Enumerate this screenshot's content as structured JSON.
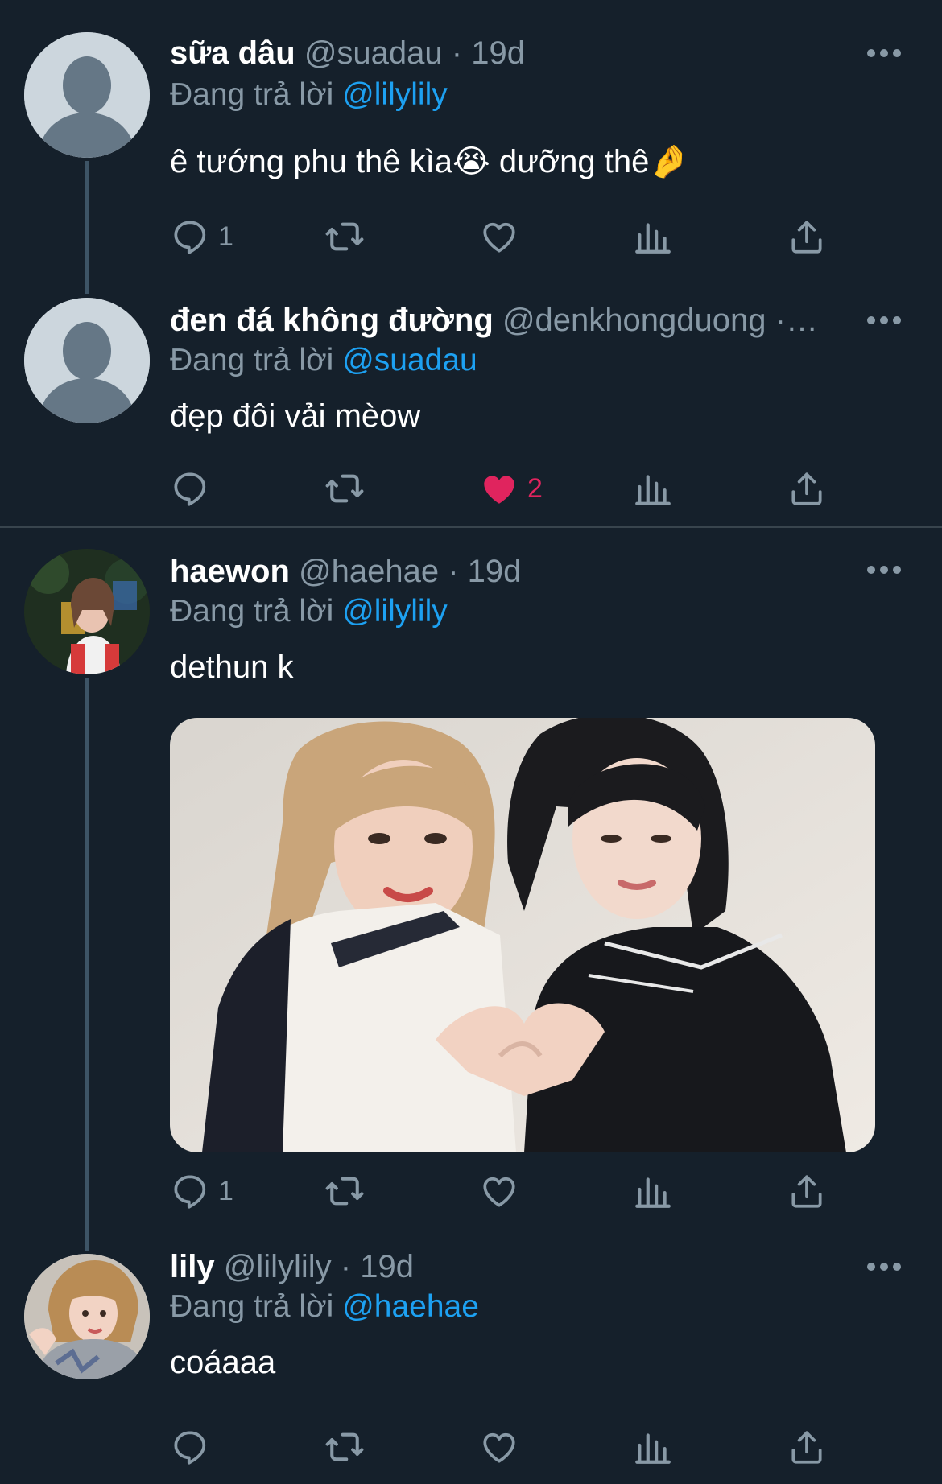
{
  "colors": {
    "background": "#15202b",
    "muted": "#8899a6",
    "link": "#1da1f2",
    "like_active": "#e0245e"
  },
  "tweets": [
    {
      "name": "sữa dâu",
      "handle": "@suadau",
      "time": "· 19d",
      "replying_label": "Đang trả lời",
      "replying_to": "@lilylily",
      "text": "ê tướng phu thê kìa😭 dưỡng thê🤌",
      "reply_count": "1",
      "retweet_count": "",
      "like_count": "",
      "liked": false
    },
    {
      "name": "đen đá không đường",
      "handle": "@denkhongduong ·…",
      "time": "",
      "replying_label": "Đang trả lời",
      "replying_to": "@suadau",
      "text": "đẹp đôi vải mèow",
      "reply_count": "",
      "retweet_count": "",
      "like_count": "2",
      "liked": true
    },
    {
      "name": "haewon",
      "handle": "@haehae",
      "time": "· 19d",
      "replying_label": "Đang trả lời",
      "replying_to": "@lilylily",
      "text": "dethun k",
      "reply_count": "1",
      "retweet_count": "",
      "like_count": "",
      "liked": false,
      "has_media": true
    },
    {
      "name": "lily",
      "handle": "@lilylily",
      "time": "· 19d",
      "replying_label": "Đang trả lời",
      "replying_to": "@haehae",
      "text": "coáaaa",
      "reply_count": "",
      "retweet_count": "",
      "like_count": "",
      "liked": false
    }
  ],
  "icons": [
    "reply-icon",
    "retweet-icon",
    "like-icon",
    "analytics-icon",
    "share-icon",
    "more-icon",
    "default-avatar-icon"
  ]
}
